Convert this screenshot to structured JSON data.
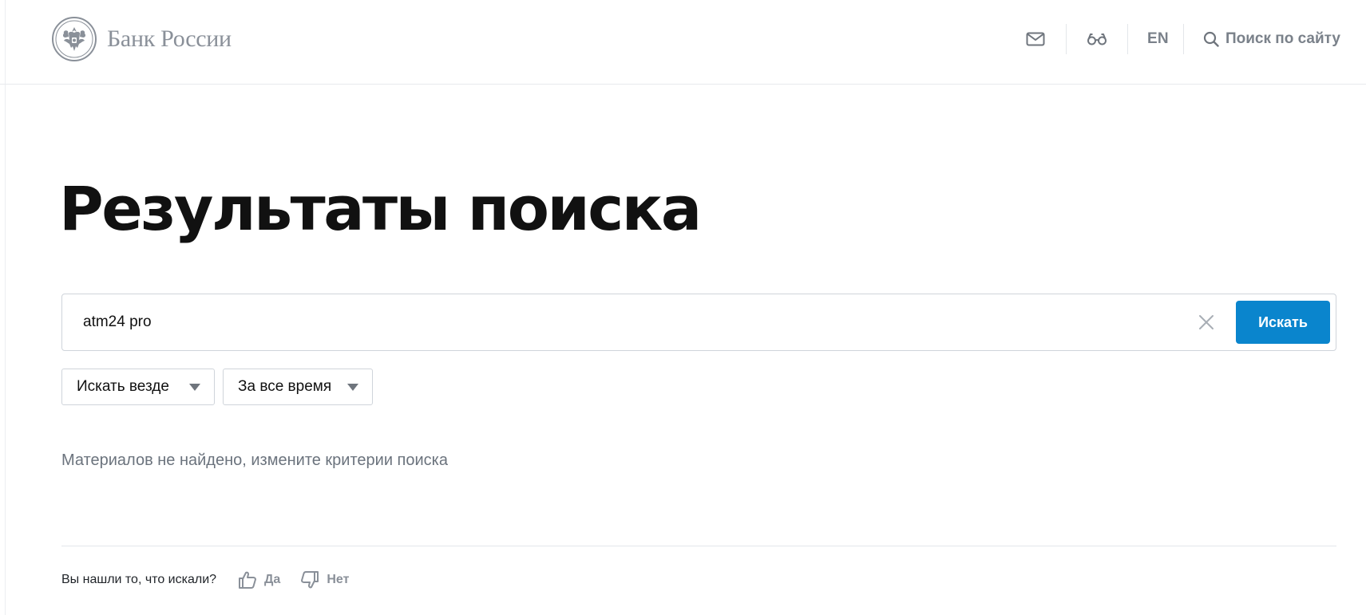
{
  "header": {
    "logo_text": "Банк России",
    "lang_label": "EN",
    "search_label": "Поиск по сайту",
    "icons": [
      "mail-icon",
      "glasses-icon",
      "search-icon"
    ]
  },
  "main": {
    "title": "Результаты поиска",
    "search": {
      "value": "atm24 pro",
      "submit_label": "Искать"
    },
    "filters": {
      "scope": "Искать везде",
      "period": "За все время"
    },
    "no_results_text": "Материалов не найдено, измените критерии поиска"
  },
  "feedback": {
    "question": "Вы нашли то, что искали?",
    "yes_label": "Да",
    "no_label": "Нет"
  },
  "colors": {
    "accent": "#0a85cd",
    "muted_text": "#6b737d",
    "icon_gray": "#7a818a"
  }
}
